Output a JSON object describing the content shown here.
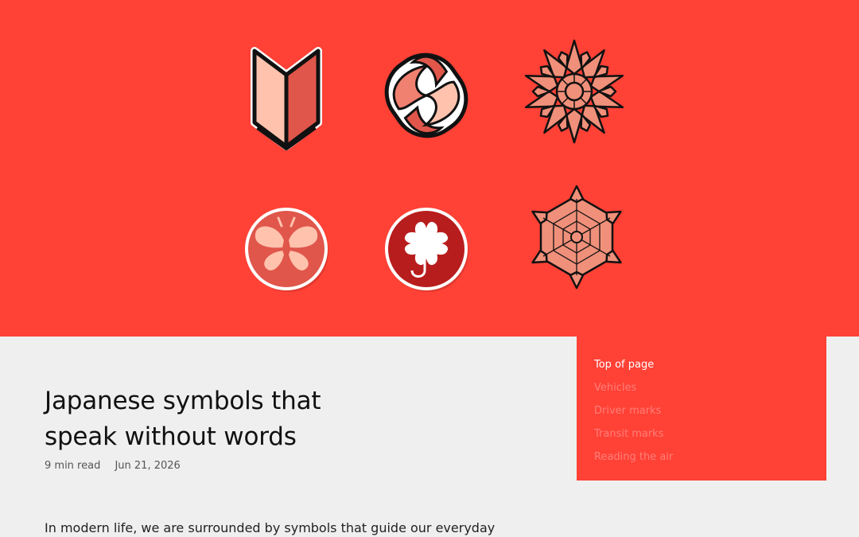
{
  "hero": {
    "background": "#ff4136",
    "symbols": [
      "shoshinsha-mark-icon",
      "s-mark-icon",
      "police-emblem-icon",
      "butterfly-mark-icon",
      "clover-mark-icon",
      "snowflake-emblem-icon"
    ]
  },
  "toc": {
    "items": [
      {
        "label": "Top of page",
        "active": true
      },
      {
        "label": "Vehicles",
        "active": false
      },
      {
        "label": "Driver marks",
        "active": false
      },
      {
        "label": "Transit marks",
        "active": false
      },
      {
        "label": "Reading the air",
        "active": false
      }
    ]
  },
  "article": {
    "title_line1": "Japanese symbols that",
    "title_line2": "speak without words",
    "read_time": "9 min read",
    "date": "Jun 21, 2026",
    "intro": "In modern life, we are surrounded by symbols that guide our everyday"
  }
}
